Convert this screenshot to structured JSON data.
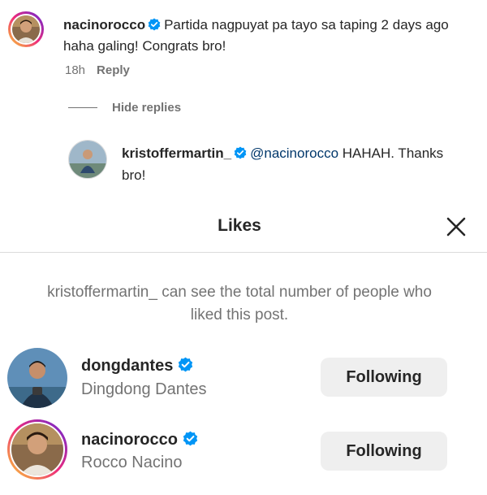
{
  "comment": {
    "username": "nacinorocco",
    "text_line1": "Partida nagpuyat pa tayo sa taping 2 days ago",
    "text_line2": "haha galing! Congrats bro!",
    "time": "18h",
    "reply_label": "Reply"
  },
  "replies": {
    "hide_label": "Hide replies",
    "items": [
      {
        "username": "kristoffermartin_",
        "mention": "@nacinorocco",
        "text_line1": "HAHAH. Thanks",
        "text_line2": "bro!"
      }
    ]
  },
  "likes_modal": {
    "title": "Likes",
    "notice_line1": "kristoffermartin_ can see the total number of people who",
    "notice_line2": "liked this post.",
    "users": [
      {
        "username": "dongdantes",
        "full_name": "Dingdong Dantes",
        "button": "Following"
      },
      {
        "username": "nacinorocco",
        "full_name": "Rocco Nacino",
        "button": "Following"
      }
    ]
  },
  "colors": {
    "verified": "#0095f6",
    "button_bg": "#efefef",
    "secondary_text": "#737373"
  },
  "icons": [
    "verified-badge-icon",
    "close-icon",
    "avatar"
  ]
}
